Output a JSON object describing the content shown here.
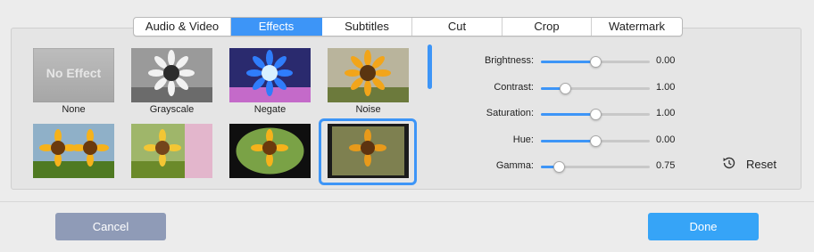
{
  "tabs": [
    {
      "label": "Audio & Video",
      "active": false
    },
    {
      "label": "Effects",
      "active": true
    },
    {
      "label": "Subtitles",
      "active": false
    },
    {
      "label": "Cut",
      "active": false
    },
    {
      "label": "Crop",
      "active": false
    },
    {
      "label": "Watermark",
      "active": false
    }
  ],
  "effects": [
    {
      "label": "None",
      "overlay_text": "No Effect"
    },
    {
      "label": "Grayscale"
    },
    {
      "label": "Negate"
    },
    {
      "label": "Noise"
    },
    {
      "label": "",
      "selected": false
    },
    {
      "label": "",
      "selected": false
    },
    {
      "label": "",
      "selected": false
    },
    {
      "label": "",
      "selected": true
    }
  ],
  "adjustments": [
    {
      "name": "Brightness:",
      "value": "0.00",
      "level": 0.5
    },
    {
      "name": "Contrast:",
      "value": "1.00",
      "level": 0.22
    },
    {
      "name": "Saturation:",
      "value": "1.00",
      "level": 0.5
    },
    {
      "name": "Hue:",
      "value": "0.00",
      "level": 0.5
    },
    {
      "name": "Gamma:",
      "value": "0.75",
      "level": 0.16
    }
  ],
  "reset": {
    "label": "Reset",
    "icon": "history-icon"
  },
  "buttons": {
    "cancel": "Cancel",
    "done": "Done"
  },
  "colors": {
    "accent": "#3d95f7",
    "cancel_bg": "#8f9bb7",
    "done_bg": "#36a4f7"
  }
}
